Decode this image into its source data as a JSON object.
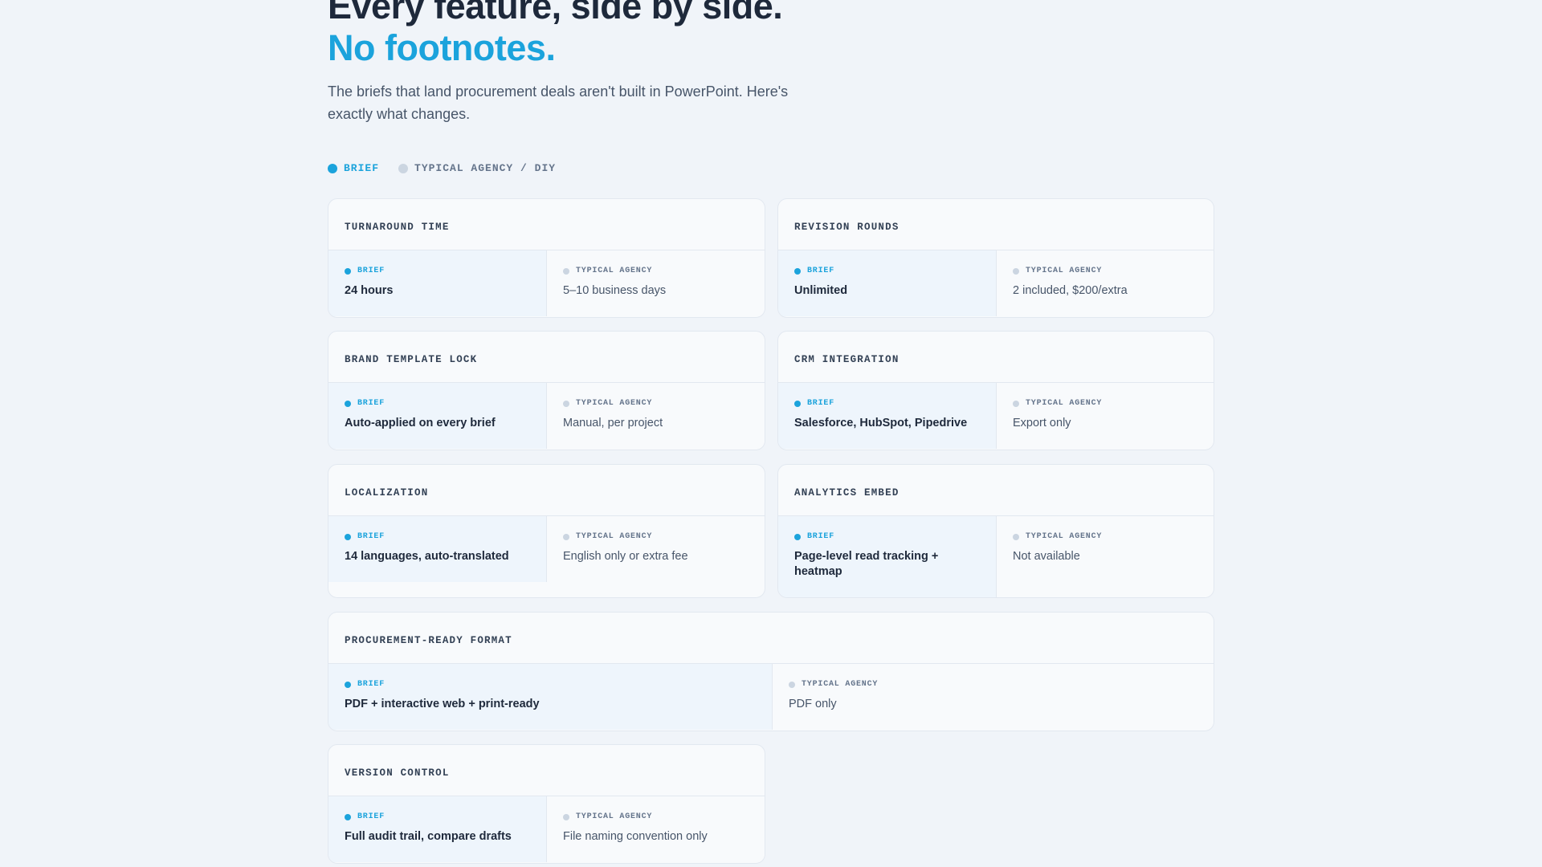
{
  "hero": {
    "title_line1": "Every feature, side by side.",
    "title_line2": "No footnotes.",
    "subtitle": "The briefs that land procurement deals aren't built in PowerPoint. Here's exactly what changes."
  },
  "legend": {
    "brief": "BRIEF",
    "agency": "TYPICAL AGENCY / DIY"
  },
  "labels": {
    "brief": "BRIEF",
    "agency": "TYPICAL AGENCY"
  },
  "colors": {
    "accent": "#1ba3dc",
    "agency_dot": "#cbd5e1",
    "background": "#f0f4f9"
  },
  "features": [
    {
      "title": "TURNAROUND TIME",
      "brief": "24 hours",
      "agency": "5–10 business days"
    },
    {
      "title": "REVISION ROUNDS",
      "brief": "Unlimited",
      "agency": "2 included, $200/extra"
    },
    {
      "title": "BRAND TEMPLATE LOCK",
      "brief": "Auto-applied on every brief",
      "agency": "Manual, per project"
    },
    {
      "title": "CRM INTEGRATION",
      "brief": "Salesforce, HubSpot, Pipedrive",
      "agency": "Export only"
    },
    {
      "title": "LOCALIZATION",
      "brief": "14 languages, auto-translated",
      "agency": "English only or extra fee"
    },
    {
      "title": "ANALYTICS EMBED",
      "brief": "Page-level read tracking + heatmap",
      "agency": "Not available"
    },
    {
      "title": "PROCUREMENT-READY FORMAT",
      "brief": "PDF + interactive web + print-ready",
      "agency": "PDF only"
    },
    {
      "title": "VERSION CONTROL",
      "brief": "Full audit trail, compare drafts",
      "agency": "File naming convention only"
    }
  ]
}
